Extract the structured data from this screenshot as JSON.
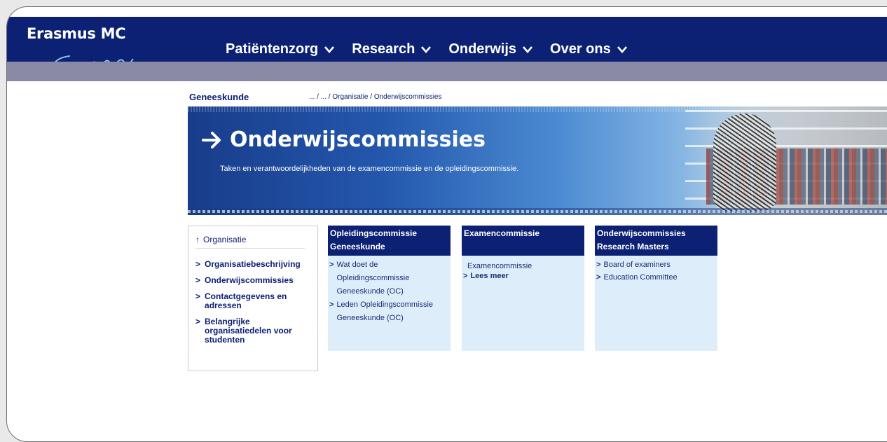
{
  "header": {
    "logo_text": "Erasmus MC",
    "nav": [
      {
        "label": "Patiëntenzorg"
      },
      {
        "label": "Research"
      },
      {
        "label": "Onderwijs"
      },
      {
        "label": "Over ons"
      }
    ]
  },
  "breadcrumb": {
    "section": "Geneeskunde",
    "path": "... / ... / Organisatie / Onderwijscommissies"
  },
  "banner": {
    "title": "Onderwijscommissies",
    "subtitle": "Taken en verantwoordelijkheden van de examencommissie en de opleidingscommissie."
  },
  "leftnav": {
    "up_label": "Organisatie",
    "items": [
      {
        "label": "Organisatiebeschrijving"
      },
      {
        "label": "Onderwijscommissies"
      },
      {
        "label": "Contactgegevens en adressen"
      },
      {
        "label": "Belangrijke organisatiedelen voor studenten"
      }
    ]
  },
  "boxes": [
    {
      "title": "Opleidingscommissie Geneeskunde",
      "links": [
        "Wat doet de Opleidingscommissie Geneeskunde (OC)",
        "Leden Opleidingscommissie Geneeskunde (OC)"
      ]
    },
    {
      "title": "Examencommissie",
      "intro": "Examencommissie",
      "more": "Lees meer"
    },
    {
      "title": "Onderwijscommissies Research Masters",
      "links": [
        "Board of examiners",
        "Education Committee"
      ]
    }
  ],
  "colors": {
    "brand_navy": "#0c2074",
    "subbar": "#8a8aa6",
    "box_bg": "#ddeefa"
  }
}
